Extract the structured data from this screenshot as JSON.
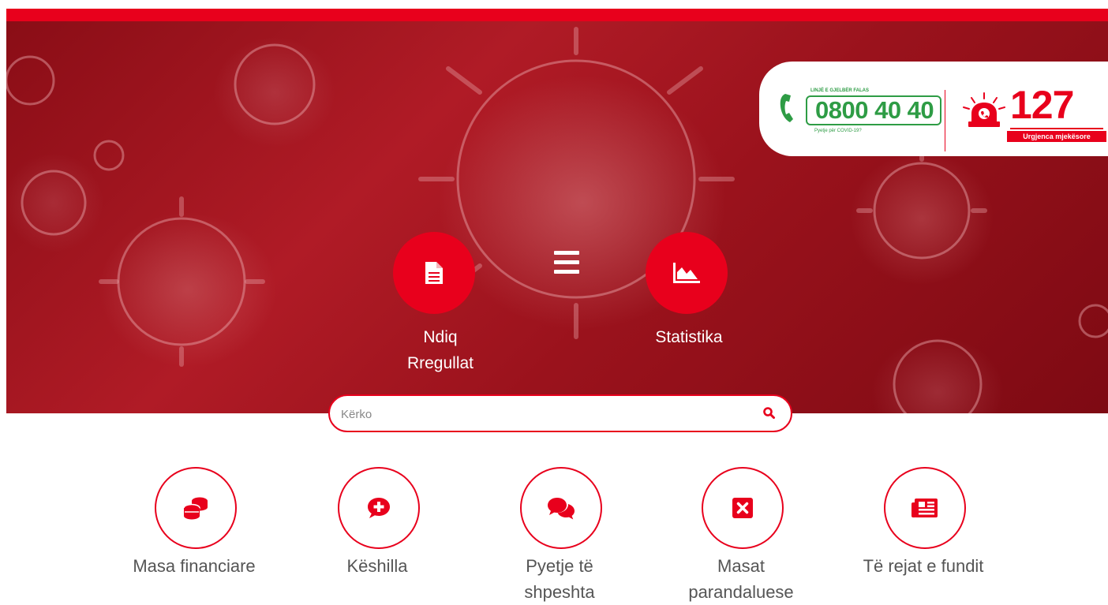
{
  "hotline": {
    "label": "LINJË E GJELBËR FALAS",
    "number": "0800 40 40",
    "sub": "Pyetje për COVID-19?"
  },
  "emergency": {
    "number": "127",
    "label": "Urgjenca mjekësore"
  },
  "hero": {
    "left_button": {
      "line1": "Ndiq",
      "line2": "Rregullat",
      "icon": "document-icon"
    },
    "right_button": {
      "label": "Statistika",
      "icon": "area-chart-icon"
    },
    "menu_icon": "hamburger-menu-icon"
  },
  "search": {
    "placeholder": "Kërko",
    "icon": "search-icon"
  },
  "categories": [
    {
      "line1": "Masa financiare",
      "line2": "",
      "icon": "coins-icon"
    },
    {
      "line1": "Këshilla",
      "line2": "",
      "icon": "medical-chat-icon"
    },
    {
      "line1": "Pyetje të",
      "line2": "shpeshta",
      "icon": "chat-bubbles-icon"
    },
    {
      "line1": "Masat",
      "line2": "parandaluese",
      "icon": "close-square-icon"
    },
    {
      "line1": "Të rejat e fundit",
      "line2": "",
      "icon": "newspaper-icon"
    }
  ],
  "colors": {
    "brand_red": "#e8001c",
    "hotline_green": "#2e9c45",
    "label_gray": "#555555"
  }
}
